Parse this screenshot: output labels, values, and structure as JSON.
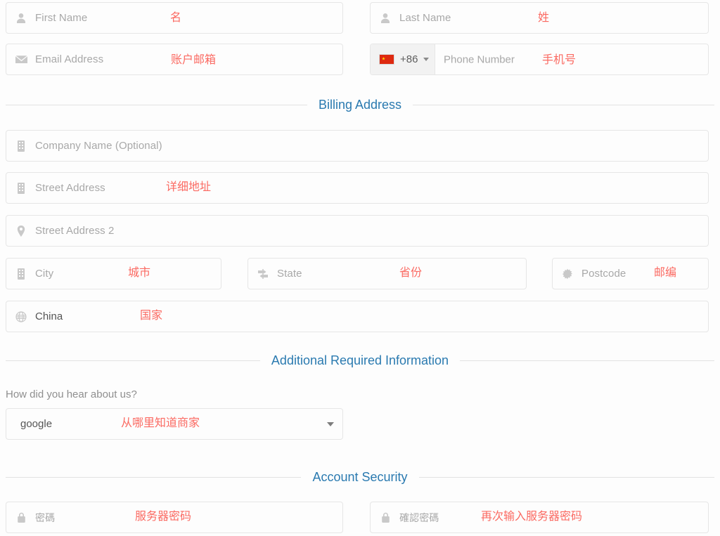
{
  "theme": {
    "accent_blue": "#2a7ab0",
    "annotation_red": "#fb6a62",
    "placeholder_grey": "#a8a8a8",
    "border_grey": "#e6e6e6",
    "page_background": "#fdfdfd",
    "prefix_background": "#f2f2f2",
    "flag_red": "#de2910",
    "flag_yellow": "#ffde00"
  },
  "personal": {
    "first_name": {
      "placeholder": "First Name",
      "annotation": "名",
      "icon": "user-icon"
    },
    "last_name": {
      "placeholder": "Last Name",
      "annotation": "姓",
      "icon": "user-icon"
    },
    "email": {
      "placeholder": "Email Address",
      "annotation": "账户邮箱",
      "icon": "envelope-icon"
    },
    "phone": {
      "country_code": "+86",
      "country_flag": "china-flag-icon",
      "placeholder": "Phone Number",
      "annotation": "手机号"
    }
  },
  "billing": {
    "heading": "Billing Address",
    "company": {
      "placeholder": "Company Name (Optional)",
      "annotation": "",
      "icon": "building-icon"
    },
    "street1": {
      "placeholder": "Street Address",
      "annotation": "详细地址",
      "icon": "building-icon"
    },
    "street2": {
      "placeholder": "Street Address 2",
      "annotation": "",
      "icon": "map-pin-icon"
    },
    "city": {
      "placeholder": "City",
      "annotation": "城市",
      "icon": "building-icon"
    },
    "state": {
      "placeholder": "State",
      "annotation": "省份",
      "icon": "signpost-icon"
    },
    "postcode": {
      "placeholder": "Postcode",
      "annotation": "邮编",
      "icon": "starburst-icon"
    },
    "country": {
      "value": "China",
      "annotation": "国家",
      "icon": "globe-icon"
    }
  },
  "additional": {
    "heading": "Additional Required Information",
    "question_label": "How did you hear about us?",
    "hear_about_us": {
      "value": "google",
      "annotation": "从哪里知道商家",
      "caret": "chevron-down-icon"
    }
  },
  "security": {
    "heading": "Account Security",
    "password": {
      "placeholder": "密碼",
      "annotation": "服务器密码",
      "icon": "lock-icon"
    },
    "confirm_password": {
      "placeholder": "確認密碼",
      "annotation": "再次输入服务器密码",
      "icon": "lock-icon"
    }
  }
}
